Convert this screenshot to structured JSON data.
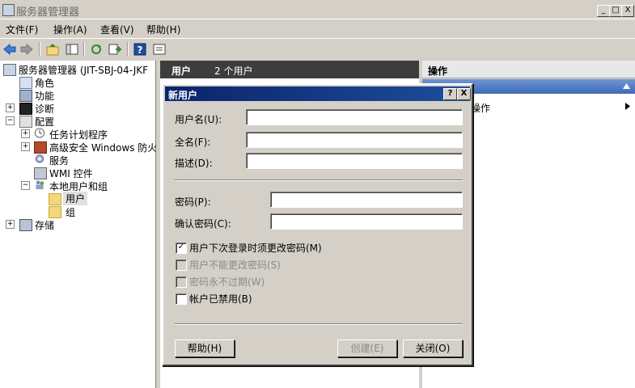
{
  "window": {
    "title": "服务器管理器"
  },
  "window_controls": {
    "minimize": "_",
    "maximize": "□",
    "close": "X"
  },
  "menu": {
    "items": [
      "文件(F)",
      "操作(A)",
      "查看(V)",
      "帮助(H)"
    ]
  },
  "tree": {
    "root": "服务器管理器 (JIT-SBJ-04-JKF",
    "roles": "角色",
    "features": "功能",
    "diagnostics": "诊断",
    "configuration": "配置",
    "task_scheduler": "任务计划程序",
    "firewall": "高级安全 Windows 防火墙",
    "services": "服务",
    "wmi": "WMI 控件",
    "local_users_groups": "本地用户和组",
    "users": "用户",
    "groups": "组",
    "storage": "存储",
    "expand_plus": "+",
    "expand_minus": "−"
  },
  "middle": {
    "header": "用户",
    "count": "2 个用户"
  },
  "actions": {
    "header": "操作",
    "item": "操作"
  },
  "dialog": {
    "title": "新用户",
    "help_btn": "?",
    "close_btn": "X",
    "username_label": "用户名(U):",
    "username_value": "",
    "fullname_label": "全名(F):",
    "fullname_value": "",
    "description_label": "描述(D):",
    "description_value": "",
    "password_label": "密码(P):",
    "password_value": "",
    "confirm_label": "确认密码(C):",
    "confirm_value": "",
    "cb_must_change": "用户下次登录时须更改密码(M)",
    "cb_cannot_change": "用户不能更改密码(S)",
    "cb_never_expires": "密码永不过期(W)",
    "cb_disabled": "帐户已禁用(B)",
    "check_mark": "✓",
    "help_button": "帮助(H)",
    "create_button": "创建(E)",
    "close_button": "关闭(O)"
  }
}
